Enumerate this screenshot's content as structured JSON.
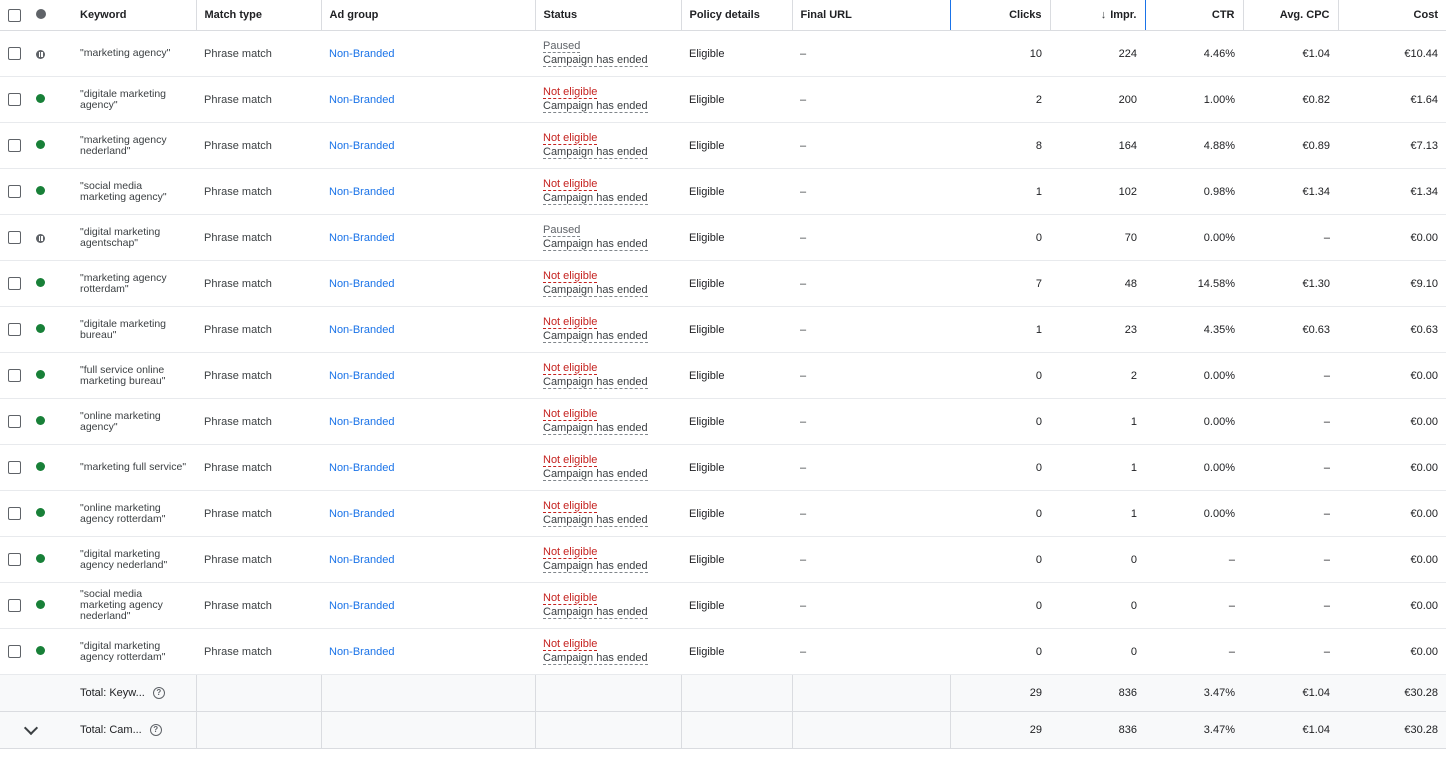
{
  "columns": {
    "keyword": "Keyword",
    "match_type": "Match type",
    "ad_group": "Ad group",
    "status": "Status",
    "policy_details": "Policy details",
    "final_url": "Final URL",
    "clicks": "Clicks",
    "impr": "Impr.",
    "ctr": "CTR",
    "avg_cpc": "Avg. CPC",
    "cost": "Cost",
    "sort_arrow": "↓"
  },
  "rows": [
    {
      "state": "paused",
      "keyword": "\"marketing agency\"",
      "match_type": "Phrase match",
      "ad_group": "Non-Branded",
      "status_top": "Paused",
      "status_bottom": "Campaign has ended",
      "policy": "Eligible",
      "final_url": "–",
      "clicks": "10",
      "impr": "224",
      "ctr": "4.46%",
      "avg_cpc": "€1.04",
      "cost": "€10.44"
    },
    {
      "state": "active",
      "keyword": "\"digitale marketing agency\"",
      "match_type": "Phrase match",
      "ad_group": "Non-Branded",
      "status_top": "Not eligible",
      "status_bottom": "Campaign has ended",
      "policy": "Eligible",
      "final_url": "–",
      "clicks": "2",
      "impr": "200",
      "ctr": "1.00%",
      "avg_cpc": "€0.82",
      "cost": "€1.64"
    },
    {
      "state": "active",
      "keyword": "\"marketing agency nederland\"",
      "match_type": "Phrase match",
      "ad_group": "Non-Branded",
      "status_top": "Not eligible",
      "status_bottom": "Campaign has ended",
      "policy": "Eligible",
      "final_url": "–",
      "clicks": "8",
      "impr": "164",
      "ctr": "4.88%",
      "avg_cpc": "€0.89",
      "cost": "€7.13"
    },
    {
      "state": "active",
      "keyword": "\"social media marketing agency\"",
      "match_type": "Phrase match",
      "ad_group": "Non-Branded",
      "status_top": "Not eligible",
      "status_bottom": "Campaign has ended",
      "policy": "Eligible",
      "final_url": "–",
      "clicks": "1",
      "impr": "102",
      "ctr": "0.98%",
      "avg_cpc": "€1.34",
      "cost": "€1.34"
    },
    {
      "state": "paused",
      "keyword": "\"digital marketing agentschap\"",
      "match_type": "Phrase match",
      "ad_group": "Non-Branded",
      "status_top": "Paused",
      "status_bottom": "Campaign has ended",
      "policy": "Eligible",
      "final_url": "–",
      "clicks": "0",
      "impr": "70",
      "ctr": "0.00%",
      "avg_cpc": "–",
      "cost": "€0.00"
    },
    {
      "state": "active",
      "keyword": "\"marketing agency rotterdam\"",
      "match_type": "Phrase match",
      "ad_group": "Non-Branded",
      "status_top": "Not eligible",
      "status_bottom": "Campaign has ended",
      "policy": "Eligible",
      "final_url": "–",
      "clicks": "7",
      "impr": "48",
      "ctr": "14.58%",
      "avg_cpc": "€1.30",
      "cost": "€9.10"
    },
    {
      "state": "active",
      "keyword": "\"digitale marketing bureau\"",
      "match_type": "Phrase match",
      "ad_group": "Non-Branded",
      "status_top": "Not eligible",
      "status_bottom": "Campaign has ended",
      "policy": "Eligible",
      "final_url": "–",
      "clicks": "1",
      "impr": "23",
      "ctr": "4.35%",
      "avg_cpc": "€0.63",
      "cost": "€0.63"
    },
    {
      "state": "active",
      "keyword": "\"full service online marketing bureau\"",
      "match_type": "Phrase match",
      "ad_group": "Non-Branded",
      "status_top": "Not eligible",
      "status_bottom": "Campaign has ended",
      "policy": "Eligible",
      "final_url": "–",
      "clicks": "0",
      "impr": "2",
      "ctr": "0.00%",
      "avg_cpc": "–",
      "cost": "€0.00"
    },
    {
      "state": "active",
      "keyword": "\"online marketing agency\"",
      "match_type": "Phrase match",
      "ad_group": "Non-Branded",
      "status_top": "Not eligible",
      "status_bottom": "Campaign has ended",
      "policy": "Eligible",
      "final_url": "–",
      "clicks": "0",
      "impr": "1",
      "ctr": "0.00%",
      "avg_cpc": "–",
      "cost": "€0.00"
    },
    {
      "state": "active",
      "keyword": "\"marketing full service\"",
      "match_type": "Phrase match",
      "ad_group": "Non-Branded",
      "status_top": "Not eligible",
      "status_bottom": "Campaign has ended",
      "policy": "Eligible",
      "final_url": "–",
      "clicks": "0",
      "impr": "1",
      "ctr": "0.00%",
      "avg_cpc": "–",
      "cost": "€0.00"
    },
    {
      "state": "active",
      "keyword": "\"online marketing agency rotterdam\"",
      "match_type": "Phrase match",
      "ad_group": "Non-Branded",
      "status_top": "Not eligible",
      "status_bottom": "Campaign has ended",
      "policy": "Eligible",
      "final_url": "–",
      "clicks": "0",
      "impr": "1",
      "ctr": "0.00%",
      "avg_cpc": "–",
      "cost": "€0.00"
    },
    {
      "state": "active",
      "keyword": "\"digital marketing agency nederland\"",
      "match_type": "Phrase match",
      "ad_group": "Non-Branded",
      "status_top": "Not eligible",
      "status_bottom": "Campaign has ended",
      "policy": "Eligible",
      "final_url": "–",
      "clicks": "0",
      "impr": "0",
      "ctr": "–",
      "avg_cpc": "–",
      "cost": "€0.00"
    },
    {
      "state": "active",
      "keyword": "\"social media marketing agency nederland\"",
      "match_type": "Phrase match",
      "ad_group": "Non-Branded",
      "status_top": "Not eligible",
      "status_bottom": "Campaign has ended",
      "policy": "Eligible",
      "final_url": "–",
      "clicks": "0",
      "impr": "0",
      "ctr": "–",
      "avg_cpc": "–",
      "cost": "€0.00"
    },
    {
      "state": "active",
      "keyword": "\"digital marketing agency rotterdam\"",
      "match_type": "Phrase match",
      "ad_group": "Non-Branded",
      "status_top": "Not eligible",
      "status_bottom": "Campaign has ended",
      "policy": "Eligible",
      "final_url": "–",
      "clicks": "0",
      "impr": "0",
      "ctr": "–",
      "avg_cpc": "–",
      "cost": "€0.00"
    }
  ],
  "totals": [
    {
      "label": "Total: Keyw...",
      "clicks": "29",
      "impr": "836",
      "ctr": "3.47%",
      "avg_cpc": "€1.04",
      "cost": "€30.28",
      "expand": false
    },
    {
      "label": "Total: Cam...",
      "clicks": "29",
      "impr": "836",
      "ctr": "3.47%",
      "avg_cpc": "€1.04",
      "cost": "€30.28",
      "expand": true
    }
  ],
  "icons": {
    "help": "?"
  },
  "colors": {
    "active": "#188038",
    "paused": "#5f6368",
    "not_eligible": "#c5221f",
    "link": "#1a73e8"
  }
}
